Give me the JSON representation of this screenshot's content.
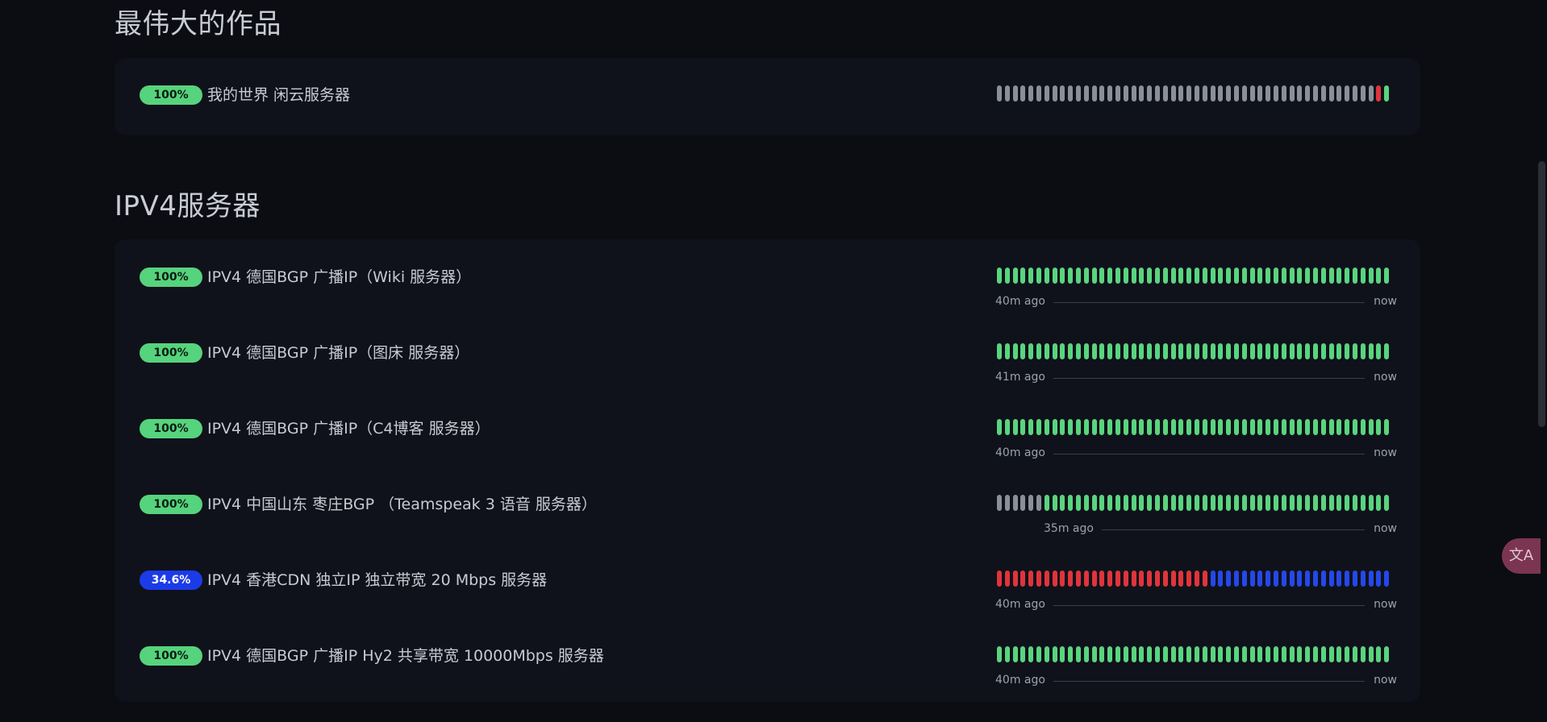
{
  "sections": [
    {
      "title": "最伟大的作品",
      "monitors": [
        {
          "uptime": "100%",
          "badge_style": "ok",
          "name": "我的世界 闲云服务器",
          "beats": [
            "g",
            "g",
            "g",
            "g",
            "g",
            "g",
            "g",
            "g",
            "g",
            "g",
            "g",
            "g",
            "g",
            "g",
            "g",
            "g",
            "g",
            "g",
            "g",
            "g",
            "g",
            "g",
            "g",
            "g",
            "g",
            "g",
            "g",
            "g",
            "g",
            "g",
            "g",
            "g",
            "g",
            "g",
            "g",
            "g",
            "g",
            "g",
            "g",
            "g",
            "g",
            "g",
            "g",
            "g",
            "g",
            "g",
            "g",
            "g",
            "r",
            "u"
          ],
          "time_start": "",
          "time_end": ""
        }
      ]
    },
    {
      "title": "IPV4服务器",
      "monitors": [
        {
          "uptime": "100%",
          "badge_style": "ok",
          "name": "IPV4 德国BGP 广播IP（Wiki 服务器）",
          "beats": [
            "u",
            "u",
            "u",
            "u",
            "u",
            "u",
            "u",
            "u",
            "u",
            "u",
            "u",
            "u",
            "u",
            "u",
            "u",
            "u",
            "u",
            "u",
            "u",
            "u",
            "u",
            "u",
            "u",
            "u",
            "u",
            "u",
            "u",
            "u",
            "u",
            "u",
            "u",
            "u",
            "u",
            "u",
            "u",
            "u",
            "u",
            "u",
            "u",
            "u",
            "u",
            "u",
            "u",
            "u",
            "u",
            "u",
            "u",
            "u",
            "u",
            "u"
          ],
          "time_start": "40m ago",
          "time_end": "now"
        },
        {
          "uptime": "100%",
          "badge_style": "ok",
          "name": "IPV4 德国BGP 广播IP（图床 服务器）",
          "beats": [
            "u",
            "u",
            "u",
            "u",
            "u",
            "u",
            "u",
            "u",
            "u",
            "u",
            "u",
            "u",
            "u",
            "u",
            "u",
            "u",
            "u",
            "u",
            "u",
            "u",
            "u",
            "u",
            "u",
            "u",
            "u",
            "u",
            "u",
            "u",
            "u",
            "u",
            "u",
            "u",
            "u",
            "u",
            "u",
            "u",
            "u",
            "u",
            "u",
            "u",
            "u",
            "u",
            "u",
            "u",
            "u",
            "u",
            "u",
            "u",
            "u",
            "u"
          ],
          "time_start": "41m ago",
          "time_end": "now"
        },
        {
          "uptime": "100%",
          "badge_style": "ok",
          "name": "IPV4 德国BGP 广播IP（C4博客 服务器）",
          "beats": [
            "u",
            "u",
            "u",
            "u",
            "u",
            "u",
            "u",
            "u",
            "u",
            "u",
            "u",
            "u",
            "u",
            "u",
            "u",
            "u",
            "u",
            "u",
            "u",
            "u",
            "u",
            "u",
            "u",
            "u",
            "u",
            "u",
            "u",
            "u",
            "u",
            "u",
            "u",
            "u",
            "u",
            "u",
            "u",
            "u",
            "u",
            "u",
            "u",
            "u",
            "u",
            "u",
            "u",
            "u",
            "u",
            "u",
            "u",
            "u",
            "u",
            "u"
          ],
          "time_start": "40m ago",
          "time_end": "now"
        },
        {
          "uptime": "100%",
          "badge_style": "ok",
          "name": "IPV4 中国山东 枣庄BGP （Teamspeak 3 语音 服务器）",
          "beats": [
            "g",
            "g",
            "g",
            "g",
            "g",
            "g",
            "u",
            "u",
            "u",
            "u",
            "u",
            "u",
            "u",
            "u",
            "u",
            "u",
            "u",
            "u",
            "u",
            "u",
            "u",
            "u",
            "u",
            "u",
            "u",
            "u",
            "u",
            "u",
            "u",
            "u",
            "u",
            "u",
            "u",
            "u",
            "u",
            "u",
            "u",
            "u",
            "u",
            "u",
            "u",
            "u",
            "u",
            "u",
            "u",
            "u",
            "u",
            "u",
            "u",
            "u"
          ],
          "time_start": "35m ago",
          "time_end": "now"
        },
        {
          "uptime": "34.6%",
          "badge_style": "blue",
          "name": "IPV4 香港CDN 独立IP 独立带宽 20 Mbps 服务器",
          "beats": [
            "r",
            "r",
            "r",
            "r",
            "r",
            "r",
            "r",
            "r",
            "r",
            "r",
            "r",
            "r",
            "r",
            "r",
            "r",
            "r",
            "r",
            "r",
            "r",
            "r",
            "r",
            "r",
            "r",
            "r",
            "r",
            "r",
            "r",
            "b",
            "b",
            "b",
            "b",
            "b",
            "b",
            "b",
            "b",
            "b",
            "b",
            "b",
            "b",
            "b",
            "b",
            "b",
            "b",
            "b",
            "b",
            "b",
            "b",
            "b",
            "b",
            "b"
          ],
          "time_start": "40m ago",
          "time_end": "now"
        },
        {
          "uptime": "100%",
          "badge_style": "ok",
          "name": "IPV4 德国BGP 广播IP Hy2 共享带宽 10000Mbps 服务器",
          "beats": [
            "u",
            "u",
            "u",
            "u",
            "u",
            "u",
            "u",
            "u",
            "u",
            "u",
            "u",
            "u",
            "u",
            "u",
            "u",
            "u",
            "u",
            "u",
            "u",
            "u",
            "u",
            "u",
            "u",
            "u",
            "u",
            "u",
            "u",
            "u",
            "u",
            "u",
            "u",
            "u",
            "u",
            "u",
            "u",
            "u",
            "u",
            "u",
            "u",
            "u",
            "u",
            "u",
            "u",
            "u",
            "u",
            "u",
            "u",
            "u",
            "u",
            "u"
          ],
          "time_start": "40m ago",
          "time_end": "now"
        }
      ]
    }
  ],
  "colors": {
    "u": "#5ad47f",
    "g": "#8b8f97",
    "r": "#e0343c",
    "b": "#2548e9"
  },
  "translate_button": {
    "label": "文A",
    "icon": "translate-icon"
  }
}
